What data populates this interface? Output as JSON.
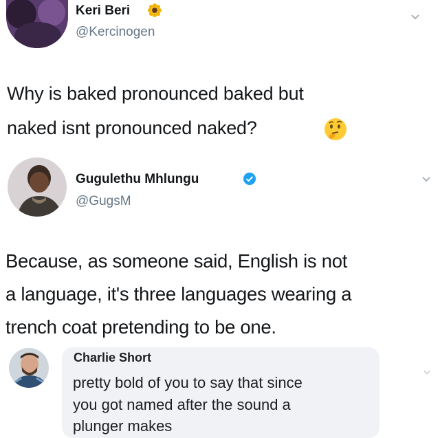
{
  "tweet": {
    "author_name": "Keri Beri",
    "author_handle": "@Kercinogen",
    "name_emoji_icon": "sunflower-icon",
    "text_line1": "Why is baked pronounced baked but",
    "text_line2": "naked isnt pronounced naked?",
    "text_emoji_icon": "thinking-face-icon"
  },
  "reply": {
    "author_name": "Gugulethu Mhlungu",
    "author_handle": "@GugsM",
    "verified_icon": "verified-badge-icon",
    "text_line1": "Because, as someone said, English is not",
    "text_line2": "a language, it's three languages wearing a",
    "text_line3": "trench coat pretending to be one."
  },
  "comment": {
    "author_name": "Charlie Short",
    "text_line1": "pretty bold of you to say that since",
    "text_line2": "you got named after the sound a",
    "text_line3": "plunger makes"
  },
  "colors": {
    "handle_gray": "#657786",
    "verified_blue": "#1da1f2",
    "bubble_bg": "#f0f2f5"
  }
}
